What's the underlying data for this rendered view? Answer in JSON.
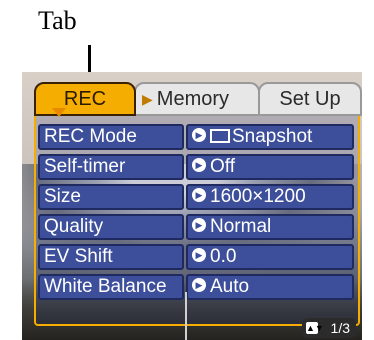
{
  "callout": {
    "label": "Tab"
  },
  "tabs": [
    {
      "label": "REC"
    },
    {
      "label": "Memory"
    },
    {
      "label": "Set Up"
    }
  ],
  "menu": [
    {
      "label": "REC Mode",
      "value": "Snapshot",
      "value_icon": "camera-icon"
    },
    {
      "label": "Self-timer",
      "value": "Off"
    },
    {
      "label": "Size",
      "value": "1600×1200"
    },
    {
      "label": "Quality",
      "value": "Normal"
    },
    {
      "label": "EV Shift",
      "value": "0.0"
    },
    {
      "label": "White Balance",
      "value": "Auto"
    }
  ],
  "page_indicator": {
    "text": "1/3"
  },
  "colors": {
    "tab_active": "#f4ad00",
    "row_bg": "#3d4f9a"
  }
}
